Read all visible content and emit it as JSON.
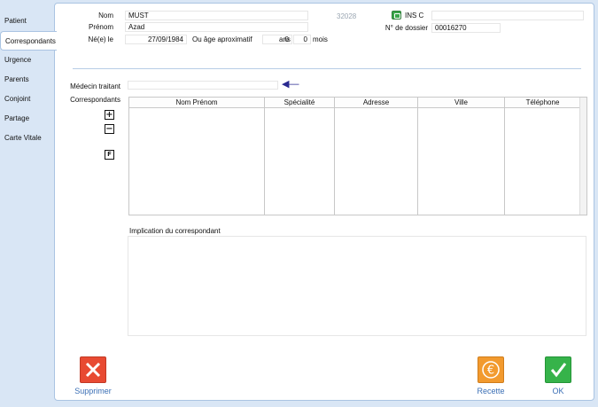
{
  "tabs": [
    {
      "label": "Patient",
      "active": false
    },
    {
      "label": "Correspondants",
      "active": true
    },
    {
      "label": "Urgence",
      "active": false
    },
    {
      "label": "Parents",
      "active": false
    },
    {
      "label": "Conjoint",
      "active": false
    },
    {
      "label": "Partage",
      "active": false
    },
    {
      "label": "Carte Vitale",
      "active": false
    }
  ],
  "patient": {
    "nom_label": "Nom",
    "nom_value": "MUST",
    "prenom_label": "Prénom",
    "prenom_value": "Azad",
    "naissance_label": "Né(e) le",
    "naissance_value": "27/09/1984",
    "age_label": "Ou âge aproximatif",
    "age_ans_value": "0",
    "ans_label": "ans",
    "age_mois_value": "0",
    "mois_label": "mois",
    "id_number": "32028",
    "ins_label": "INS C",
    "ins_value": "",
    "dossier_label": "N° de dossier",
    "dossier_value": "00016270"
  },
  "correspondants": {
    "medecin_label": "Médecin traitant",
    "medecin_value": "",
    "label": "Correspondants",
    "add_symbol": "+",
    "remove_symbol": "−",
    "f_symbol": "F",
    "columns": [
      "Nom Prénom",
      "Spécialité",
      "Adresse",
      "Ville",
      "Téléphone"
    ],
    "rows": [],
    "implication_label": "Implication du correspondant",
    "implication_value": ""
  },
  "actions": {
    "delete_label": "Supprimer",
    "recette_label": "Recette",
    "ok_label": "OK"
  },
  "colors": {
    "background": "#d9e6f5",
    "delete": "#e84a32",
    "recette": "#f29a2e",
    "ok": "#36b34a",
    "link": "#3b6fb5"
  },
  "icons": {
    "delete": "close-x-icon",
    "recette": "euro-icon",
    "ok": "checkmark-icon",
    "ins": "card-icon",
    "medecin": "arrow-left-icon"
  }
}
